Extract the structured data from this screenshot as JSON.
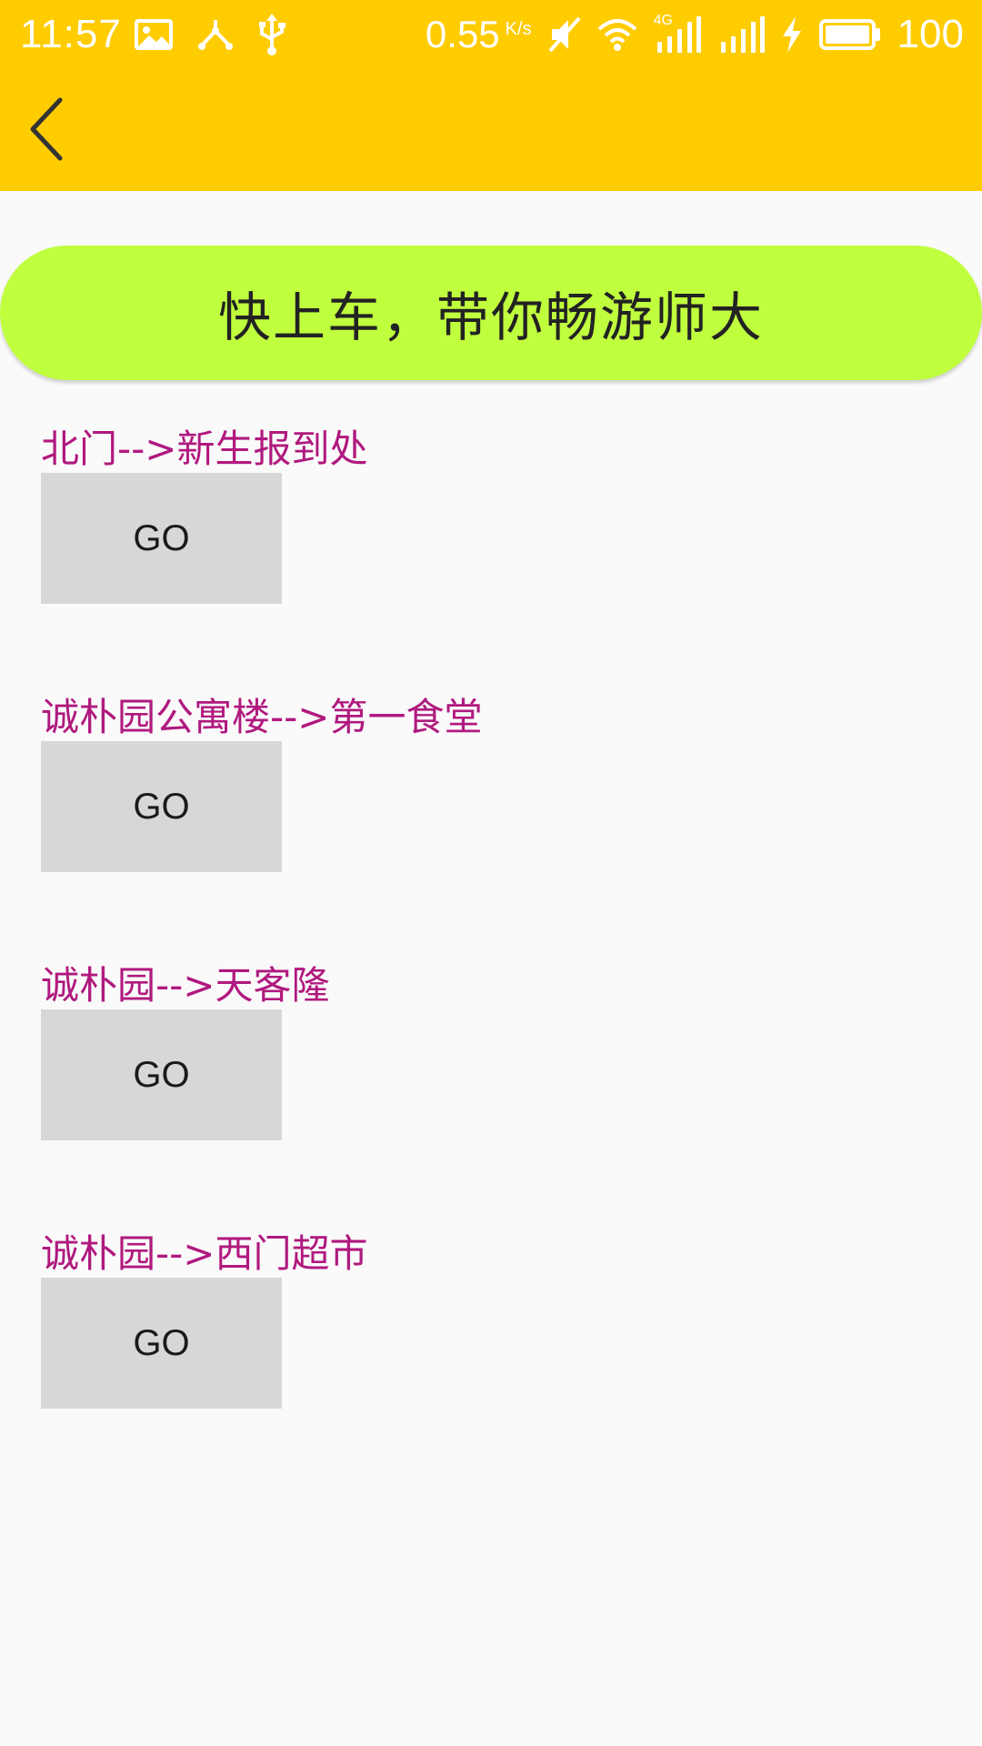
{
  "status_bar": {
    "time": "11:57",
    "net_speed": "0.55",
    "net_speed_unit": "K/s",
    "network_type": "4G",
    "battery_level": "100",
    "icons": [
      "image-icon",
      "share-icon",
      "usb-icon",
      "mute-icon",
      "wifi-icon",
      "signal-4g-icon",
      "signal-icon",
      "charging-icon",
      "battery-icon"
    ]
  },
  "toolbar": {
    "back_icon": "chevron-left-icon"
  },
  "banner": {
    "text": "快上车，带你畅游师大"
  },
  "routes": [
    {
      "label": "北门-->新生报到处",
      "button": "GO"
    },
    {
      "label": "诚朴园公寓楼-->第一食堂",
      "button": "GO"
    },
    {
      "label": "诚朴园-->天客隆",
      "button": "GO"
    },
    {
      "label": "诚朴园-->西门超市",
      "button": "GO"
    }
  ],
  "colors": {
    "app_bar": "#ffcc00",
    "banner": "#c0ff3e",
    "route_label": "#b0197e",
    "button_bg": "#d6d7d7",
    "page_bg": "#fafafa"
  }
}
